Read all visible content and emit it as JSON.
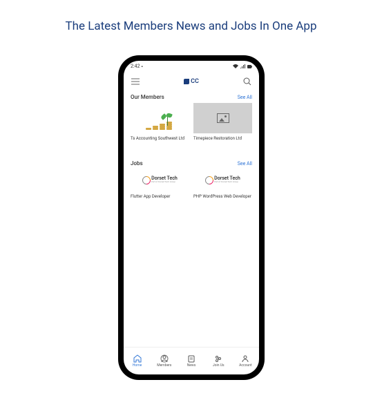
{
  "tagline": "The Latest Members News and Jobs In One App",
  "status": {
    "time": "2:42",
    "timeIcon": "◧"
  },
  "header": {
    "logo": "CC"
  },
  "members": {
    "title": "Our Members",
    "seeAll": "See All",
    "items": [
      {
        "title": "Ts Accounting Southwest Ltd"
      },
      {
        "title": "Timepiece Restoration Ltd"
      }
    ]
  },
  "jobs": {
    "title": "Jobs",
    "seeAll": "See All",
    "items": [
      {
        "title": "Flutter App Developer",
        "company": "Dorset Tech",
        "tagline": "Part of Dorset Tech Group"
      },
      {
        "title": "PHP WordPress Web Developer",
        "company": "Dorset Tech",
        "tagline": "Part of Dorset Tech Group"
      }
    ]
  },
  "nav": {
    "home": "Home",
    "members": "Members",
    "news": "News",
    "joinUs": "Join Us",
    "account": "Account"
  }
}
